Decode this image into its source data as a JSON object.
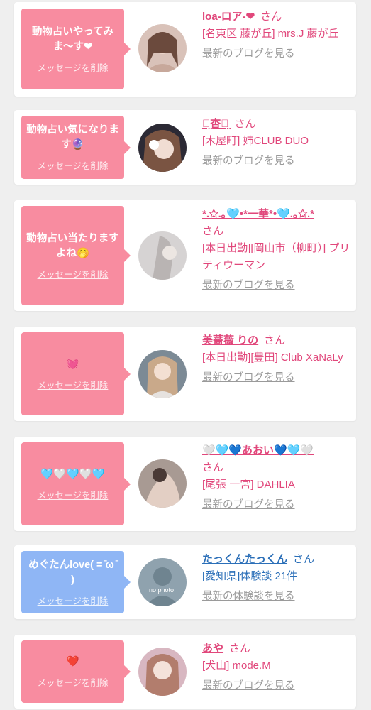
{
  "items": [
    {
      "message": "動物占いやってみま〜す❤",
      "delete_label": "メッセージを削除",
      "name": "loa-ロア-❤",
      "honorific": "さん",
      "detail": "[名東区 藤が丘] mrs.J 藤が丘",
      "link": "最新のブログを見る"
    },
    {
      "message": "動物占い気になります🔮",
      "delete_label": "メッセージを削除",
      "name": "ꪔ̤̮杏ꪔ̤̮",
      "honorific": "さん",
      "detail": "[木屋町] 姉CLUB DUO",
      "link": "最新のブログを見る"
    },
    {
      "message": "動物占い当たりますよね🤭",
      "delete_label": "メッセージを削除",
      "name": "*.✩.｡🩵•*一華*•🩵.｡✩.*",
      "honorific": "さん",
      "detail": "[本日出勤][岡山市（柳町）] プリティウーマン",
      "link": "最新のブログを見る"
    },
    {
      "message": "💓",
      "delete_label": "メッセージを削除",
      "name": "美薔薇 りの",
      "honorific": "さん",
      "detail": "[本日出勤][豊田] Club XaNaLy",
      "link": "最新のブログを見る"
    },
    {
      "message": "🩵🤍🩵🤍🩵",
      "delete_label": "メッセージを削除",
      "name": "🤍🩵💙あおい💙🩵🤍",
      "honorific": "さん",
      "detail": "[尾張 一宮] DAHLIA",
      "link": "最新のブログを見る"
    },
    {
      "message": "めぐたんlove( = ̄ω ̄ )",
      "delete_label": "メッセージを削除",
      "name": "たっくんたっくん",
      "honorific": "さん",
      "detail": "[愛知県]体験談 21件",
      "link": "最新の体験談を見る",
      "avatar_text": "no photo"
    },
    {
      "message": "❤️",
      "delete_label": "メッセージを削除",
      "name": "あや",
      "honorific": "さん",
      "detail": "[犬山] mode.M",
      "link": "最新のブログを見る"
    }
  ],
  "colors": {
    "pink_bubble": "#f88ca0",
    "blue_bubble": "#8fb6f5",
    "pink_text": "#e1477b",
    "blue_text": "#2b6fb8",
    "link_gray": "#9a9a9a",
    "background": "#efefef"
  }
}
